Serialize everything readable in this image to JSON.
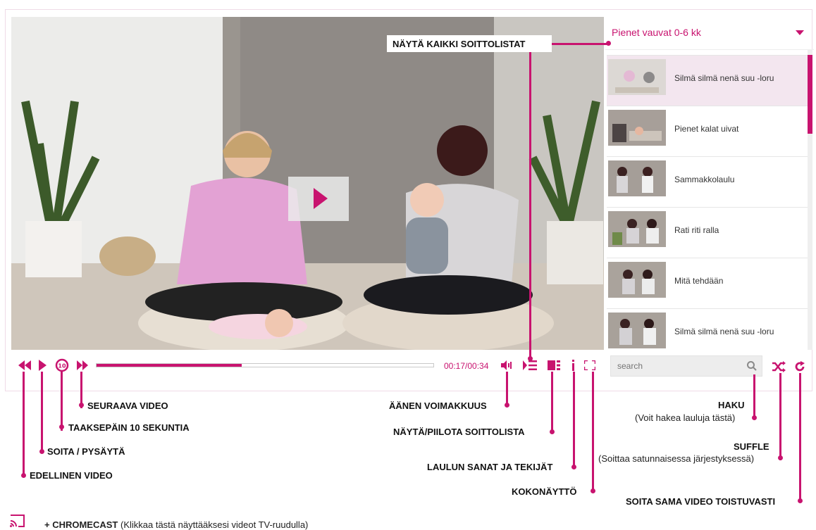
{
  "colors": {
    "accent": "#c8136f",
    "active_item_bg": "#f3e6ef"
  },
  "player": {
    "time_display": "00:17/00:34",
    "progress_fraction": 0.43,
    "big_play_icon": "play-icon"
  },
  "playlist": {
    "title": "Pienet vauvat 0-6 kk",
    "dropdown_icon": "caret-down-icon",
    "items": [
      {
        "label": "Silmä silmä nenä suu -loru",
        "active": true
      },
      {
        "label": "Pienet kalat uivat",
        "active": false
      },
      {
        "label": "Sammakkolaulu",
        "active": false
      },
      {
        "label": "Rati riti ralla",
        "active": false
      },
      {
        "label": "Mitä tehdään",
        "active": false
      },
      {
        "label": "Silmä silmä nenä suu -loru",
        "active": false
      }
    ]
  },
  "search": {
    "placeholder": "search"
  },
  "annotations": {
    "show_all_playlists": "NÄYTÄ KAIKKI SOITTOLISTAT",
    "next_video": "SEURAAVA VIDEO",
    "back_10": "TAAKSEPÄIN 10 SEKUNTIA",
    "play_pause": "SOITA / PYSÄYTÄ",
    "previous_video": "EDELLINEN VIDEO",
    "volume": "ÄÄNEN VOIMAKKUUS",
    "toggle_playlist": "NÄYTÄ/PIILOTA SOITTOLISTA",
    "lyrics_credits": "LAULUN SANAT JA TEKIJÄT",
    "fullscreen": "KOKONÄYTTÖ",
    "search_title": "HAKU",
    "search_desc": "(Voit hakea lauluja tästä)",
    "shuffle_title": "SUFFLE",
    "shuffle_desc": "(Soittaa satunnaisessa järjestyksessä)",
    "repeat": "SOITA SAMA VIDEO TOISTUVASTI"
  },
  "chromecast": {
    "label_bold": "+ CHROMECAST",
    "label_rest": " (Klikkaa tästä näyttääksesi videot TV-ruudulla)"
  }
}
